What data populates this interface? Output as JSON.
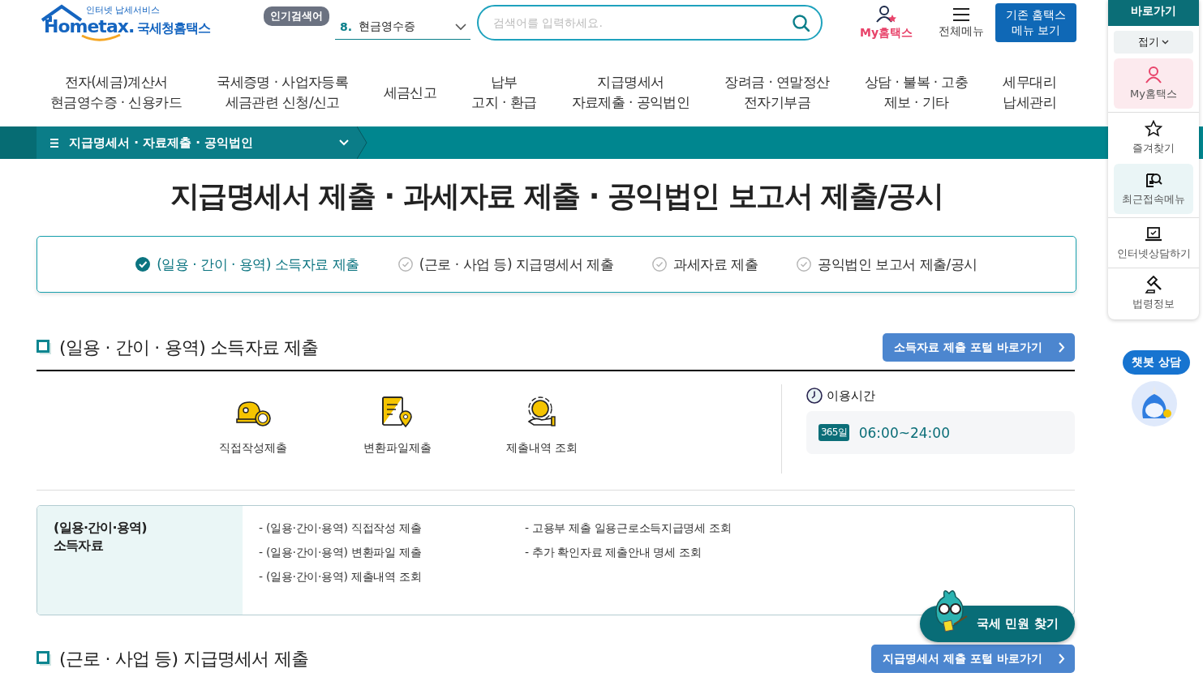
{
  "header": {
    "logo": {
      "tagline": "인터넷 납세서비스",
      "wordmark": "Hometax.",
      "name": "국세청홈택스"
    },
    "popular": {
      "label": "인기검색어",
      "rank": "8.",
      "term": "현금영수증"
    },
    "search": {
      "placeholder": "검색어를 입력하세요."
    },
    "my_hometax": "My홈택스",
    "all_menu": "전체메뉴",
    "legacy_button": "기존 홈택스 메뉴 보기"
  },
  "nav": [
    {
      "lines": [
        "전자(세금)계산서",
        "현금영수증 · 신용카드"
      ]
    },
    {
      "lines": [
        "국세증명 · 사업자등록",
        "세금관련 신청/신고"
      ]
    },
    {
      "lines": [
        "세금신고"
      ]
    },
    {
      "lines": [
        "납부",
        "고지 · 환급"
      ]
    },
    {
      "lines": [
        "지급명세서",
        "자료제출 · 공익법인"
      ]
    },
    {
      "lines": [
        "장려금 · 연말정산",
        "전자기부금"
      ]
    },
    {
      "lines": [
        "상담 · 불복 · 고충",
        "제보 · 기타"
      ]
    },
    {
      "lines": [
        "세무대리",
        "납세관리"
      ]
    }
  ],
  "breadcrumb": {
    "label": "지급명세서 · 자료제출 · 공익법인"
  },
  "title": "지급명세서 제출 · 과세자료 제출 · 공익법인 보고서 제출/공시",
  "tabs": [
    {
      "label": "(일용 · 간이 · 용역) 소득자료 제출",
      "selected": true
    },
    {
      "label": "(근로 · 사업 등) 지급명세서 제출",
      "selected": false
    },
    {
      "label": "과세자료 제출",
      "selected": false
    },
    {
      "label": "공익법인 보고서 제출/공시",
      "selected": false
    }
  ],
  "section": {
    "heading": "(일용 · 간이 · 용역) 소득자료 제출",
    "portal_button": "소득자료 제출 포털 바로가기",
    "shortcuts": [
      {
        "label": "직접작성제출"
      },
      {
        "label": "변환파일제출"
      },
      {
        "label": "제출내역 조회"
      }
    ],
    "hours": {
      "label": "이용시간",
      "badge": "365일",
      "time": "06:00~24:00"
    },
    "info": {
      "category": [
        "(일용·간이·용역)",
        "소득자료"
      ],
      "links": [
        [
          "- (일용·간이·용역) 직접작성 제출",
          "- (일용·간이·용역) 변환파일 제출",
          "- (일용·간이·용역) 제출내역 조회"
        ],
        [
          "- 고용부 제출 일용근로소득지급명세 조회",
          "- 추가 확인자료 제출안내 명세 조회"
        ]
      ]
    }
  },
  "next_section": {
    "heading": "(근로 · 사업 등) 지급명세서 제출",
    "portal_button": "지급명세서 제출 포털 바로가기"
  },
  "quick_menu": {
    "title": "바로가기",
    "collapse": "접기",
    "items": [
      {
        "label": "My홈택스",
        "color": "#fceaee"
      },
      {
        "label": "즐겨찾기"
      },
      {
        "label": "최근접속메뉴",
        "color": "#eaf5f6"
      },
      {
        "label": "인터넷상담하기"
      },
      {
        "label": "법령정보"
      }
    ]
  },
  "chatbot": {
    "label": "챗봇 상담"
  },
  "civil_button": "국세 민원 찾기"
}
